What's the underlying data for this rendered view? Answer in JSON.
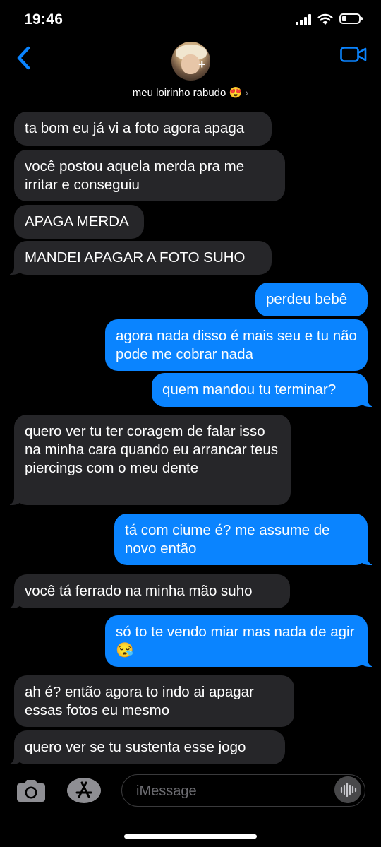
{
  "status_bar": {
    "time": "19:46"
  },
  "header": {
    "contact_name": "meu loirinho rabudo 😍",
    "chevron": "›"
  },
  "messages": [
    {
      "sender": "received",
      "text": "ta bom eu já vi a foto agora apaga"
    },
    {
      "sender": "received",
      "text": "você postou aquela merda pra me irritar e conseguiu"
    },
    {
      "sender": "received",
      "text": "APAGA MERDA"
    },
    {
      "sender": "received",
      "text": "MANDEI APAGAR A FOTO SUHO"
    },
    {
      "sender": "sent",
      "text": "perdeu bebê"
    },
    {
      "sender": "sent",
      "text": "agora nada disso é mais seu e tu não pode me cobrar nada"
    },
    {
      "sender": "sent",
      "text": "quem mandou tu terminar?"
    },
    {
      "sender": "received",
      "text": "quero ver tu ter coragem de falar isso na minha cara quando eu arrancar teus piercings com o meu dente"
    },
    {
      "sender": "sent",
      "text": "tá com ciume é? me assume de novo então"
    },
    {
      "sender": "received",
      "text": "você tá ferrado na minha mão suho"
    },
    {
      "sender": "sent",
      "text": "só to te vendo miar mas nada de agir 😪"
    },
    {
      "sender": "received",
      "text": "ah é? então agora to indo ai apagar essas fotos eu mesmo"
    },
    {
      "sender": "received",
      "text": "quero ver se tu sustenta esse jogo"
    }
  ],
  "input_bar": {
    "placeholder": "iMessage"
  },
  "icons": {
    "back": "chevron-left-icon",
    "video": "video-camera-icon",
    "camera": "camera-icon",
    "apps": "app-store-icon",
    "audio": "audio-waveform-icon"
  },
  "colors": {
    "accent": "#0a84ff",
    "received_bubble": "#262629",
    "background": "#000000"
  }
}
